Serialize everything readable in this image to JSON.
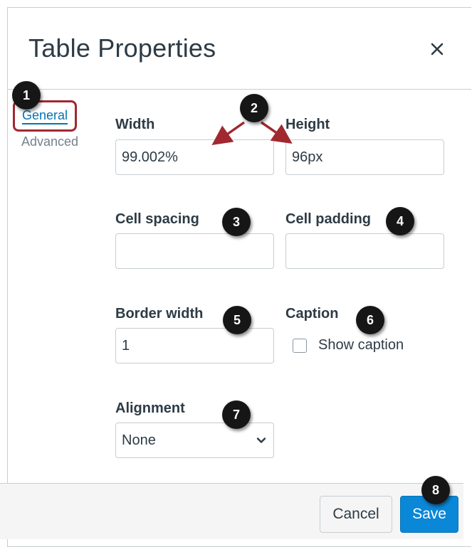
{
  "dialog": {
    "title": "Table Properties",
    "close_icon": "close-icon"
  },
  "tabs": [
    {
      "label": "General",
      "selected": true
    },
    {
      "label": "Advanced",
      "selected": false
    }
  ],
  "fields": {
    "width": {
      "label": "Width",
      "value": "99.002%"
    },
    "height": {
      "label": "Height",
      "value": "96px"
    },
    "cell_spacing": {
      "label": "Cell spacing",
      "value": ""
    },
    "cell_padding": {
      "label": "Cell padding",
      "value": ""
    },
    "border_width": {
      "label": "Border width",
      "value": "1"
    },
    "caption": {
      "label": "Caption",
      "checkbox_label": "Show caption",
      "checked": false
    },
    "alignment": {
      "label": "Alignment",
      "selected": "None"
    }
  },
  "footer": {
    "cancel_label": "Cancel",
    "save_label": "Save"
  },
  "callouts": [
    "1",
    "2",
    "3",
    "4",
    "5",
    "6",
    "7",
    "8"
  ],
  "colors": {
    "accent": "#0374b5",
    "save_button": "#0b87d8",
    "highlight_border": "#a12830",
    "arrow": "#a12830",
    "badge": "#161616"
  }
}
